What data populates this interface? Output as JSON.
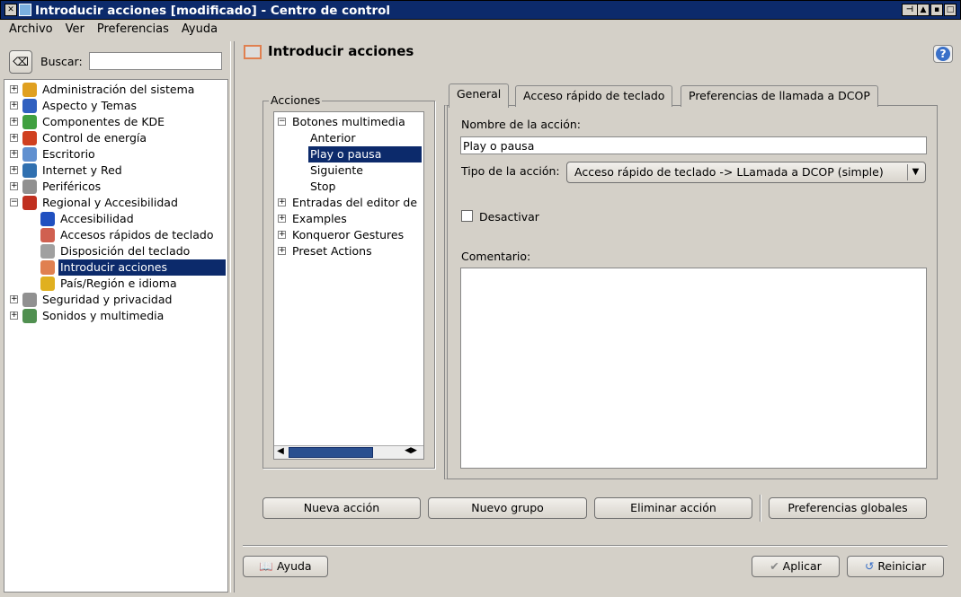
{
  "window": {
    "title": "Introducir acciones [modificado] - Centro de control"
  },
  "menu": [
    "Archivo",
    "Ver",
    "Preferencias",
    "Ayuda"
  ],
  "sidebar": {
    "search_label": "Buscar:",
    "search_value": "",
    "items": [
      {
        "label": "Administración del sistema",
        "level": 0,
        "exp": "+",
        "icon": "#e0a020"
      },
      {
        "label": "Aspecto y Temas",
        "level": 0,
        "exp": "+",
        "icon": "#3060c0"
      },
      {
        "label": "Componentes de KDE",
        "level": 0,
        "exp": "+",
        "icon": "#40a040"
      },
      {
        "label": "Control de energía",
        "level": 0,
        "exp": "+",
        "icon": "#d04020"
      },
      {
        "label": "Escritorio",
        "level": 0,
        "exp": "+",
        "icon": "#6090d0"
      },
      {
        "label": "Internet y Red",
        "level": 0,
        "exp": "+",
        "icon": "#3070b0"
      },
      {
        "label": "Periféricos",
        "level": 0,
        "exp": "+",
        "icon": "#909090"
      },
      {
        "label": "Regional y Accesibilidad",
        "level": 0,
        "exp": "-",
        "icon": "#c03020"
      },
      {
        "label": "Accesibilidad",
        "level": 1,
        "icon": "#2050c0"
      },
      {
        "label": "Accesos rápidos de teclado",
        "level": 1,
        "icon": "#d06050"
      },
      {
        "label": "Disposición del teclado",
        "level": 1,
        "icon": "#a0a0a0"
      },
      {
        "label": "Introducir acciones",
        "level": 1,
        "icon": "#e08050",
        "selected": true
      },
      {
        "label": "País/Región e idioma",
        "level": 1,
        "icon": "#e0b020"
      },
      {
        "label": "Seguridad y privacidad",
        "level": 0,
        "exp": "+",
        "icon": "#909090"
      },
      {
        "label": "Sonidos y multimedia",
        "level": 0,
        "exp": "+",
        "icon": "#509050"
      }
    ]
  },
  "page": {
    "title": "Introducir acciones",
    "actions_group": "Acciones",
    "actions": [
      {
        "label": "Botones multimedia",
        "level": 0,
        "exp": "-"
      },
      {
        "label": "Anterior",
        "level": 1
      },
      {
        "label": "Play o pausa",
        "level": 1,
        "selected": true
      },
      {
        "label": "Siguiente",
        "level": 1
      },
      {
        "label": "Stop",
        "level": 1
      },
      {
        "label": "Entradas del editor de",
        "level": 0,
        "exp": "+"
      },
      {
        "label": "Examples",
        "level": 0,
        "exp": "+"
      },
      {
        "label": "Konqueror Gestures",
        "level": 0,
        "exp": "+"
      },
      {
        "label": "Preset Actions",
        "level": 0,
        "exp": "+"
      }
    ],
    "tabs": [
      "General",
      "Acceso rápido de teclado",
      "Preferencias de llamada a DCOP"
    ],
    "name_label": "Nombre de la acción:",
    "name_value": "Play o pausa",
    "type_label": "Tipo de la acción:",
    "type_value": "Acceso rápido de teclado -> LLamada a DCOP (simple)",
    "disable_label": "Desactivar",
    "disable_checked": false,
    "comment_label": "Comentario:",
    "comment_value": "",
    "buttons": [
      "Nueva acción",
      "Nuevo grupo",
      "Eliminar acción",
      "Preferencias globales"
    ]
  },
  "footer": {
    "help": "Ayuda",
    "apply": "Aplicar",
    "reset": "Reiniciar"
  }
}
